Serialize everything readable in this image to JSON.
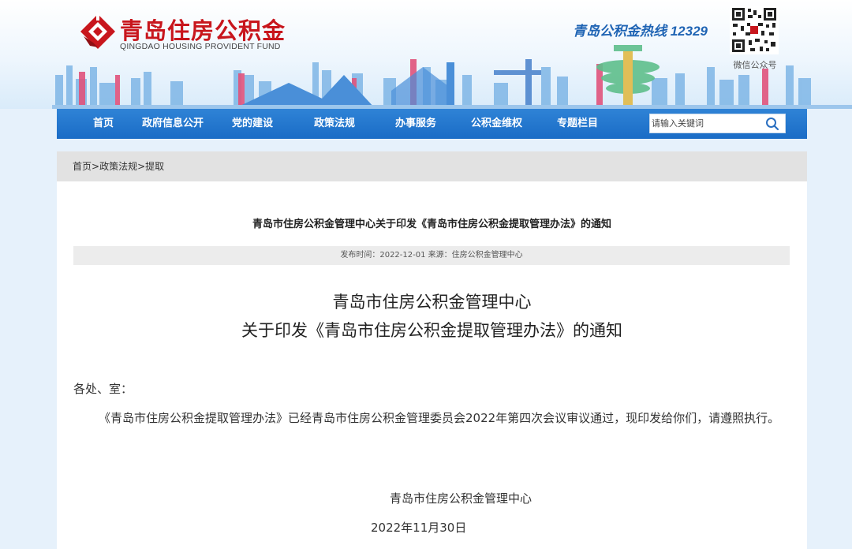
{
  "header": {
    "logo_title": "青岛住房公积金",
    "logo_subtitle": "QINGDAO HOUSING PROVIDENT FUND",
    "hotline": "青岛公积金热线 12329",
    "qr_label": "微信公众号"
  },
  "nav": {
    "items": [
      "首页",
      "政府信息公开",
      "党的建设",
      "政策法规",
      "办事服务",
      "公积金维权",
      "专题栏目"
    ],
    "search_placeholder": "请输入关键词"
  },
  "breadcrumb": {
    "home": "首页",
    "sep": ">",
    "section": "政策法规",
    "current": "提取"
  },
  "article": {
    "title": "青岛市住房公积金管理中心关于印发《青岛市住房公积金提取管理办法》的通知",
    "meta": "发布时间：2022-12-01 来源：住房公积金管理中心",
    "doc_title_line1": "青岛市住房公积金管理中心",
    "doc_title_line2": "关于印发《青岛市住房公积金提取管理办法》的通知",
    "salutation": "各处、室：",
    "body": "《青岛市住房公积金提取管理办法》已经青岛市住房公积金管理委员会2022年第四次会议审议通过，现印发给你们，请遵照执行。",
    "signature": "青岛市住房公积金管理中心",
    "date": "2022年11月30日"
  },
  "colors": {
    "brand_red": "#c8161d",
    "nav_blue": "#1a6cc6",
    "hotline_blue": "#1f64b4",
    "page_bg": "#e6f1fb"
  }
}
